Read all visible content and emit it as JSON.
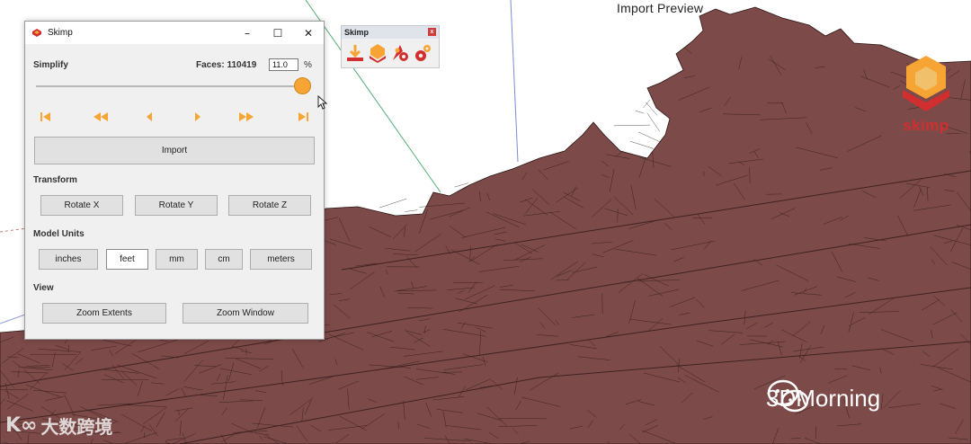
{
  "viewport": {
    "preview_title": "Import Preview",
    "colors": {
      "terrain": "#7c4a48",
      "terrain_dark": "#5e3533",
      "mesh_line": "#2a1514",
      "background": "#ffffff",
      "guide_line": "#2a9a55"
    }
  },
  "brand": {
    "logo_text": "skimp",
    "icon": "skimp-logo-icon",
    "color": "#d12f2f"
  },
  "watermarks": {
    "left": "大数跨境",
    "right": "3DMorning"
  },
  "toolbar": {
    "title": "Skimp",
    "close_glyph": "x",
    "buttons": [
      {
        "name": "import-icon"
      },
      {
        "name": "simplify-icon"
      },
      {
        "name": "settings-icon"
      },
      {
        "name": "tools-icon"
      }
    ]
  },
  "dialog": {
    "title": "Skimp",
    "window_controls": {
      "minimize": "–",
      "maximize": "☐",
      "close": "✕"
    },
    "simplify": {
      "label": "Simplify",
      "faces_label": "Faces:",
      "faces_value": "110419",
      "percent_value": "11.0",
      "percent_sign": "%",
      "slider_level": 1.0
    },
    "nav_buttons": [
      "first-icon",
      "fast-back-icon",
      "back-icon",
      "forward-icon",
      "fast-forward-icon",
      "last-icon"
    ],
    "accent": "#f6a535",
    "import_label": "Import",
    "transform": {
      "label": "Transform",
      "buttons": [
        "Rotate X",
        "Rotate Y",
        "Rotate Z"
      ]
    },
    "model_units": {
      "label": "Model Units",
      "options": [
        "inches",
        "feet",
        "mm",
        "cm",
        "meters"
      ],
      "selected": "feet"
    },
    "view": {
      "label": "View",
      "buttons": [
        "Zoom Extents",
        "Zoom Window"
      ]
    }
  }
}
